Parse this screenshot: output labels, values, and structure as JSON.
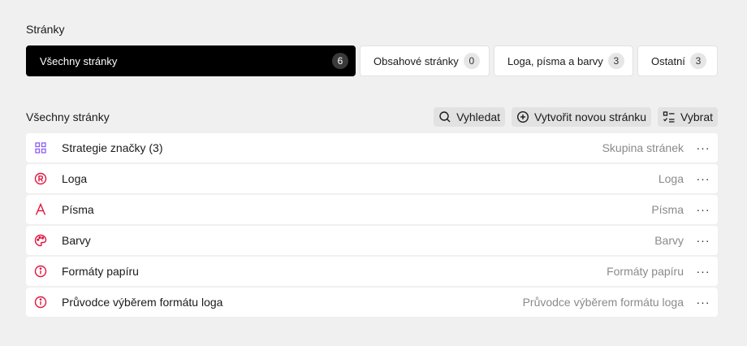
{
  "section": {
    "title": "Stránky"
  },
  "filters": [
    {
      "label": "Všechny stránky",
      "count": "6"
    },
    {
      "label": "Obsahové stránky",
      "count": "0"
    },
    {
      "label": "Loga, písma a barvy",
      "count": "3"
    },
    {
      "label": "Ostatní",
      "count": "3"
    }
  ],
  "list": {
    "title": "Všechny stránky",
    "actions": {
      "search": "Vyhledat",
      "create": "Vytvořit novou stránku",
      "select": "Vybrat"
    },
    "rows": [
      {
        "name": "Strategie značky (3)",
        "type": "Skupina stránek",
        "icon": "grid-icon"
      },
      {
        "name": "Loga",
        "type": "Loga",
        "icon": "registered-icon"
      },
      {
        "name": "Písma",
        "type": "Písma",
        "icon": "font-icon"
      },
      {
        "name": "Barvy",
        "type": "Barvy",
        "icon": "palette-icon"
      },
      {
        "name": "Formáty papíru",
        "type": "Formáty papíru",
        "icon": "info-icon"
      },
      {
        "name": "Průvodce výběrem formátu loga",
        "type": "Průvodce výběrem formátu loga",
        "icon": "info-icon"
      }
    ]
  },
  "more_label": "···",
  "colors": {
    "accent": "#e0163f",
    "group_icon": "#8b5cf6",
    "active_filter": "#000000"
  }
}
